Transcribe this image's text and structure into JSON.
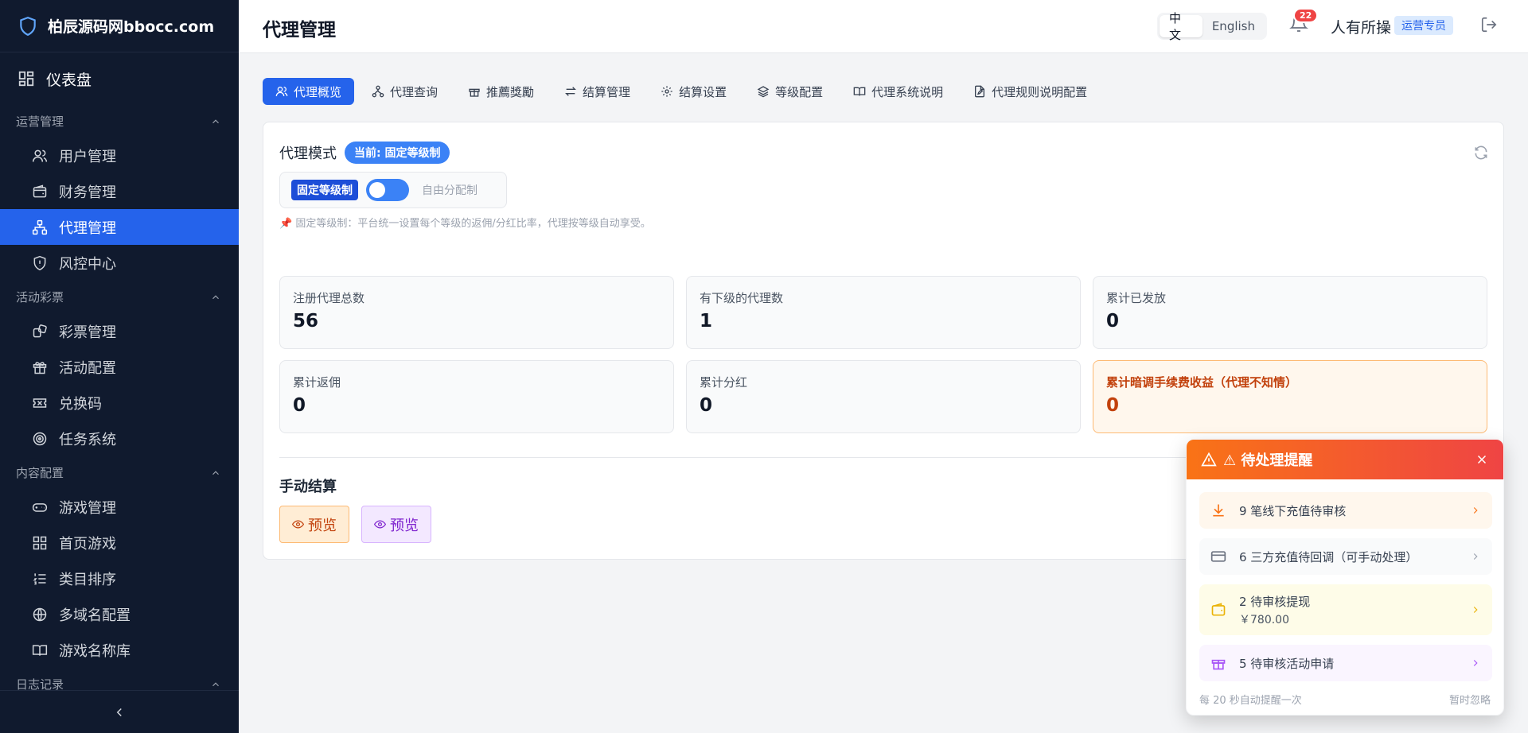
{
  "sidebar": {
    "brand": "柏辰源码网bbocc.com",
    "dashboard": "仪表盘",
    "groups": {
      "ops": "运营管理",
      "activity": "活动彩票",
      "content": "内容配置",
      "logs": "日志记录"
    },
    "items": {
      "users": "用户管理",
      "finance": "财务管理",
      "agents": "代理管理",
      "risk": "风控中心",
      "lottery": "彩票管理",
      "events": "活动配置",
      "codes": "兑换码",
      "tasks": "任务系统",
      "games": "游戏管理",
      "home_games": "首页游戏",
      "category_sort": "类目排序",
      "domains": "多域名配置",
      "game_names": "游戏名称库"
    }
  },
  "header": {
    "title": "代理管理",
    "lang_zh": "中文",
    "lang_en": "English",
    "notif_count": "22",
    "username": "人有所操",
    "role": "运营专员"
  },
  "tabs": [
    {
      "label": "代理概览"
    },
    {
      "label": "代理查询"
    },
    {
      "label": "推薦獎勵"
    },
    {
      "label": "结算管理"
    },
    {
      "label": "结算设置"
    },
    {
      "label": "等级配置"
    },
    {
      "label": "代理系统说明"
    },
    {
      "label": "代理规则说明配置"
    }
  ],
  "mode": {
    "title": "代理模式",
    "current": "当前: 固定等级制",
    "fixed_label": "固定等级制",
    "free_label": "自由分配制",
    "note": "📌 固定等级制：平台统一设置每个等级的返佣/分红比率，代理按等级自动享受。"
  },
  "stats": [
    {
      "label": "注册代理总数",
      "value": "56"
    },
    {
      "label": "有下级的代理数",
      "value": "1"
    },
    {
      "label": "累计已发放",
      "value": "0"
    },
    {
      "label": "累计返佣",
      "value": "0"
    },
    {
      "label": "累计分红",
      "value": "0"
    },
    {
      "label": "累计暗调手续费收益（代理不知情）",
      "value": "0"
    }
  ],
  "manual": {
    "title": "手动结算",
    "preview1": "预览",
    "preview2": "预览"
  },
  "alerts": {
    "title": "待处理提醒",
    "items": [
      {
        "text": "9 笔线下充值待审核"
      },
      {
        "text": "6 三方充值待回调（可手动处理）"
      },
      {
        "text": "2 待审核提现",
        "sub": "￥780.00"
      },
      {
        "text": "5 待审核活动申请"
      }
    ],
    "footer_left": "每 20 秒自动提醒一次",
    "footer_right": "暂时忽略"
  },
  "colors": {
    "sidebar_bg": "#101a2e",
    "accent": "#2563eb",
    "warn": "#c2410c"
  }
}
